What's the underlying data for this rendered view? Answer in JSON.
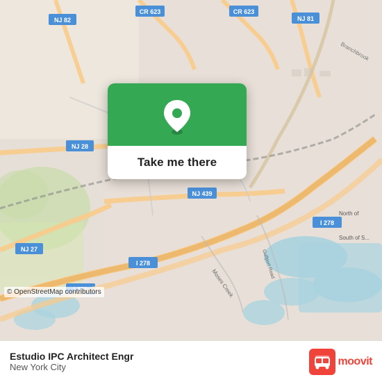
{
  "map": {
    "attribution": "© OpenStreetMap contributors"
  },
  "card": {
    "label": "Take me there"
  },
  "bottom_bar": {
    "location_name": "Estudio IPC Architect Engr",
    "location_city": "New York City"
  },
  "moovit": {
    "text": "moovit"
  },
  "icons": {
    "pin": "📍",
    "moovit_logo": "🚌"
  }
}
